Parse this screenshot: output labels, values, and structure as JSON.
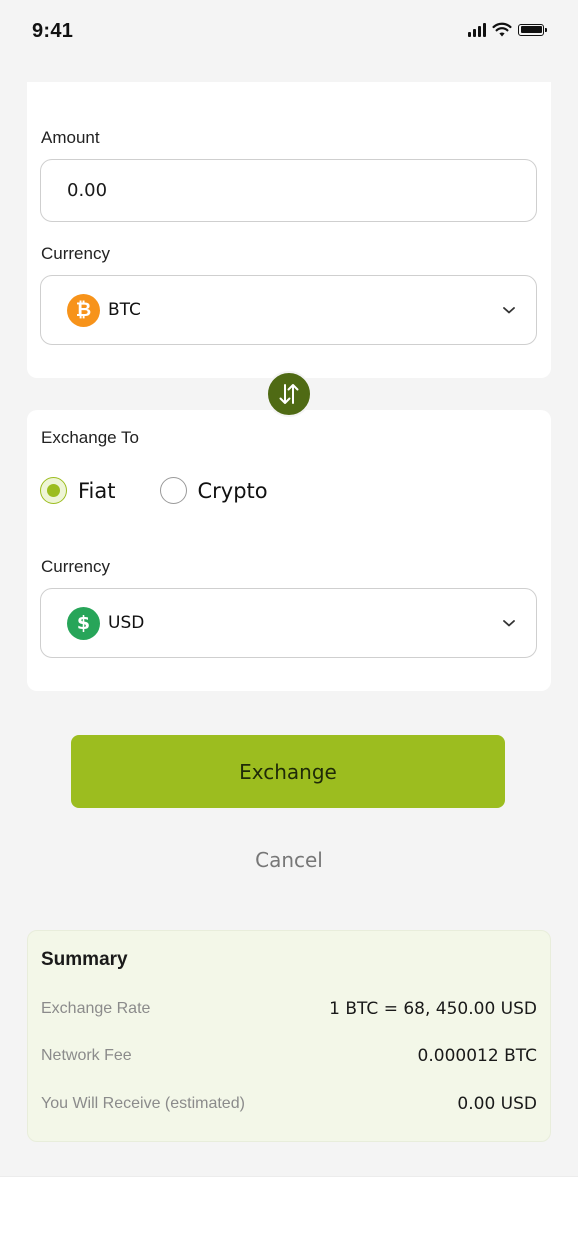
{
  "status_bar": {
    "time": "9:41"
  },
  "form": {
    "amount_label": "Amount",
    "amount_placeholder": "0.00",
    "from_currency_label": "Currency",
    "from_currency": {
      "code": "BTC",
      "icon": "bitcoin-icon",
      "icon_glyph": "₿",
      "color": "#F7931A"
    },
    "exchange_to_label": "Exchange To",
    "exchange_options": [
      {
        "label": "Fiat",
        "selected": true
      },
      {
        "label": "Crypto",
        "selected": false
      }
    ],
    "to_currency_label": "Currency",
    "to_currency": {
      "code": "USD",
      "icon": "dollar-icon",
      "icon_glyph": "$",
      "color": "#27A559"
    }
  },
  "actions": {
    "exchange_label": "Exchange",
    "cancel_label": "Cancel"
  },
  "summary": {
    "title": "Summary",
    "rows": [
      {
        "key": "Exchange Rate",
        "value": "1 BTC = 68, 450.00 USD"
      },
      {
        "key": "Network Fee",
        "value": "0.000012 BTC"
      },
      {
        "key": "You Will Receive (estimated)",
        "value": "0.00 USD"
      }
    ]
  },
  "colors": {
    "accent": "#9CBD1F",
    "swap_button": "#4F6A14"
  }
}
